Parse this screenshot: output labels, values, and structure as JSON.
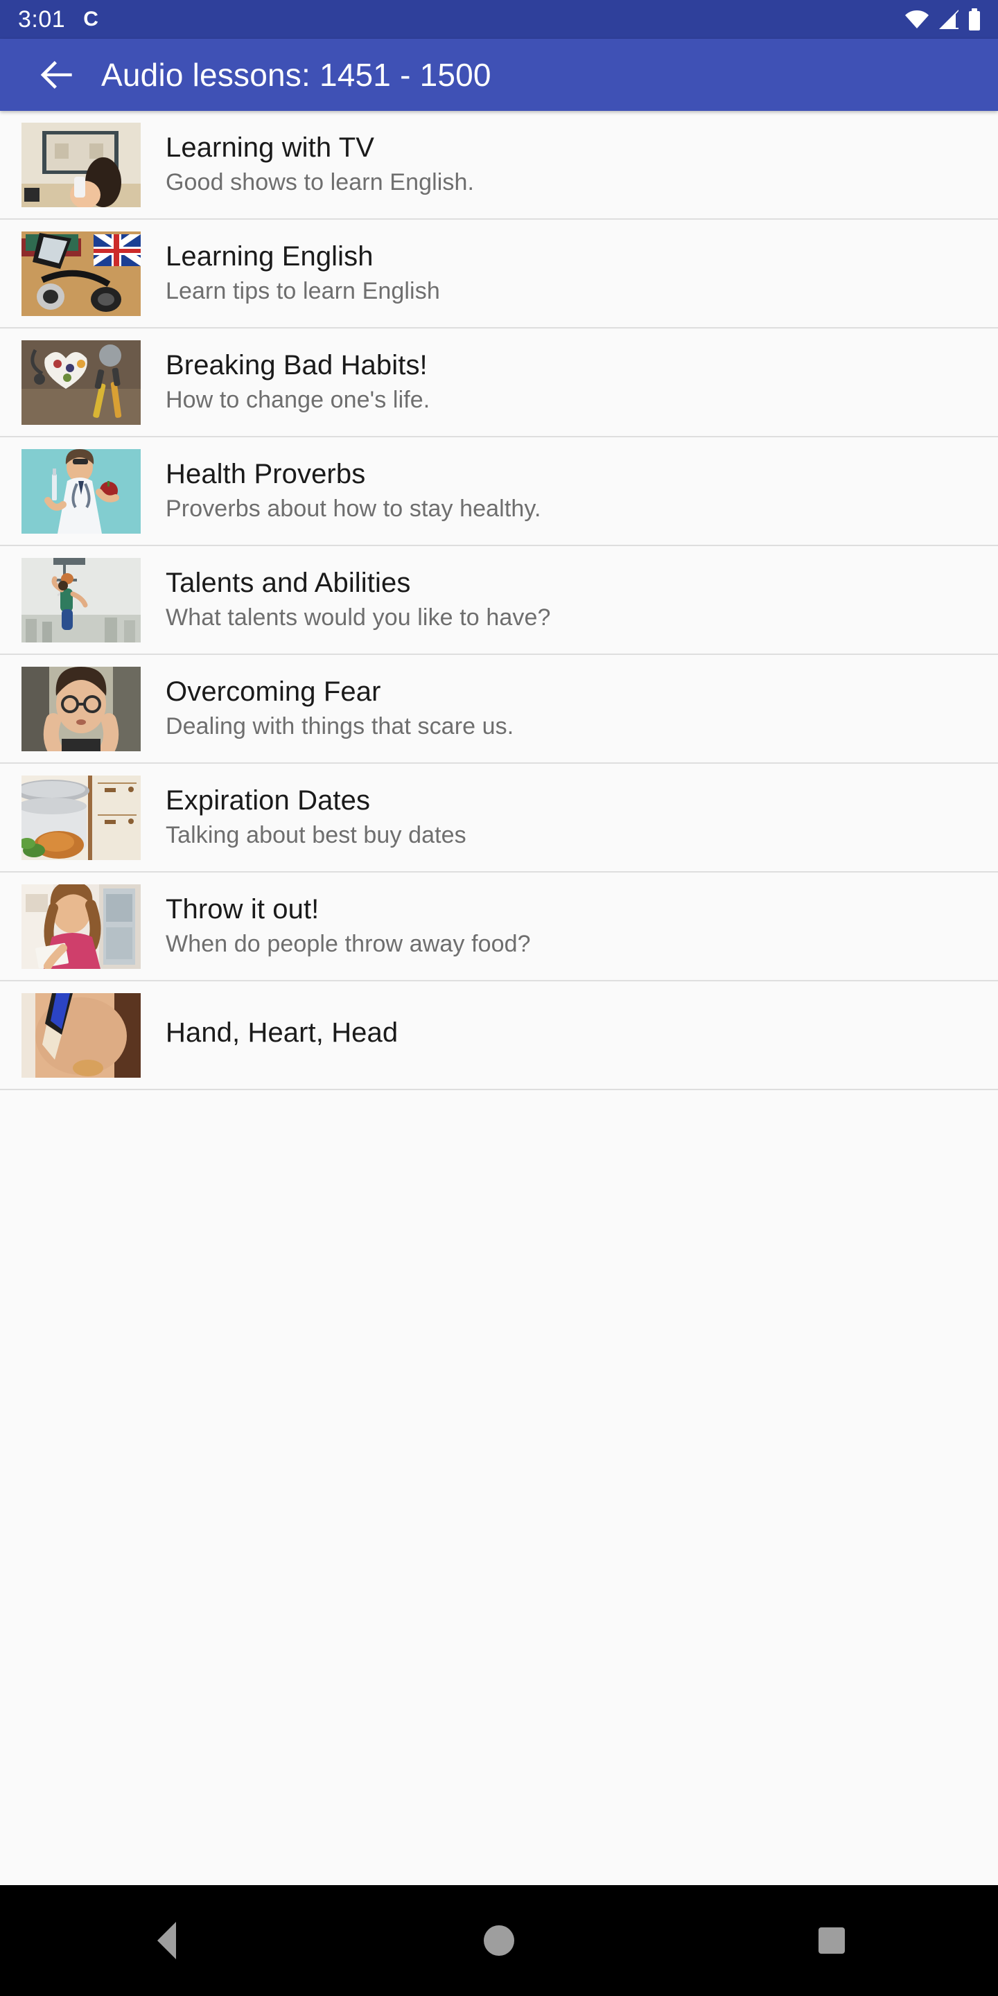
{
  "status_bar": {
    "time": "3:01",
    "notification_glyph": "C",
    "icons": [
      "wifi-icon",
      "signal-icon",
      "battery-icon"
    ],
    "background_color": "#2F409B"
  },
  "app_bar": {
    "back_label": "Back",
    "title": "Audio lessons: 1451 - 1500",
    "background_color": "#3F51B5"
  },
  "lessons": [
    {
      "title": "Learning with TV",
      "subtitle": "Good shows to learn English.",
      "thumb": "woman-watching-tv-with-remote"
    },
    {
      "title": "Learning English",
      "subtitle": "Learn tips to learn English",
      "thumb": "headphones-books-tablet-union-jack-flag"
    },
    {
      "title": "Breaking Bad Habits!",
      "subtitle": "How to change one's life.",
      "thumb": "heart-plate-fruit-stethoscope-tools"
    },
    {
      "title": "Health Proverbs",
      "subtitle": "Proverbs about how to stay healthy.",
      "thumb": "doctor-holding-apple-and-syringe-teal-background"
    },
    {
      "title": "Talents and Abilities",
      "subtitle": "What talents would you like to have?",
      "thumb": "basketball-player-dunking-over-city-skyline"
    },
    {
      "title": "Overcoming Fear",
      "subtitle": "Dealing with things that scare us.",
      "thumb": "worried-woman-with-glasses-hands-on-face"
    },
    {
      "title": "Expiration Dates",
      "subtitle": "Talking about best buy dates",
      "thumb": "kitchen-pot-with-food-and-cabinet"
    },
    {
      "title": "Throw it out!",
      "subtitle": "When do people throw away food?",
      "thumb": "woman-at-open-refrigerator-reading-label"
    },
    {
      "title": "Hand, Heart, Head",
      "subtitle": "",
      "thumb": "hands-on-skin-partial"
    }
  ],
  "nav_bar": {
    "back_label": "Back",
    "home_label": "Home",
    "recents_label": "Recents",
    "background_color": "#000000"
  }
}
